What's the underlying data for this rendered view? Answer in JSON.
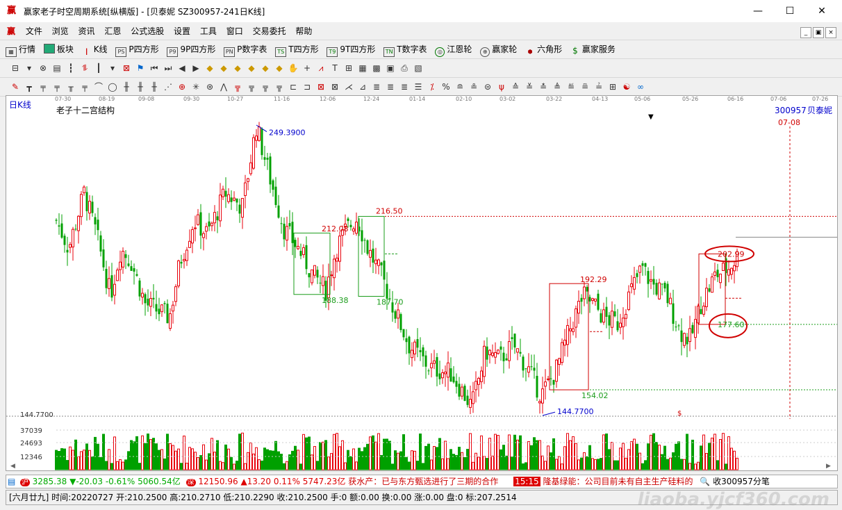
{
  "window": {
    "title": "赢家老子时空周期系统[纵横版] - [贝泰妮  SZ300957-241日K线]",
    "logo": "赢",
    "min_glyph": "—",
    "max_glyph": "☐",
    "close_glyph": "✕"
  },
  "menu": [
    "文件",
    "浏览",
    "资讯",
    "汇恩",
    "公式选股",
    "设置",
    "工具",
    "窗口",
    "交易委托",
    "帮助"
  ],
  "mdi_buttons": [
    "_",
    "▣",
    "×"
  ],
  "toolbar1": [
    {
      "icon": "grid-icon",
      "label": "行情"
    },
    {
      "icon": "blocks-icon",
      "label": "板块"
    },
    {
      "icon": "kline-icon",
      "label": "K线"
    },
    {
      "icon": "ps-icon",
      "label": "P四方形"
    },
    {
      "icon": "p9-icon",
      "label": "9P四方形"
    },
    {
      "icon": "pn-icon",
      "label": "P数字表"
    },
    {
      "icon": "ts-icon",
      "label": "T四方形"
    },
    {
      "icon": "t9-icon",
      "label": "9T四方形"
    },
    {
      "icon": "tn-icon",
      "label": "T数字表"
    },
    {
      "icon": "target-icon",
      "label": "江恩轮"
    },
    {
      "icon": "wheel-icon",
      "label": "赢家轮"
    },
    {
      "icon": "hexagon-icon",
      "label": "六角形"
    },
    {
      "icon": "dollar-icon",
      "label": "赢家服务"
    }
  ],
  "chart_header": {
    "period": "日K线",
    "indicator": "老子十二宫结构",
    "code": "300957",
    "name": "贝泰妮",
    "cursor_date": "07-08"
  },
  "date_axis": [
    "07-30",
    "08-19",
    "09-08",
    "09-30",
    "10-27",
    "11-16",
    "12-06",
    "12-24",
    "01-14",
    "02-10",
    "03-02",
    "03-22",
    "04-13",
    "05-06",
    "05-26",
    "06-16",
    "07-06",
    "07-26"
  ],
  "price_labels": {
    "high": "249.3900",
    "low": "144.7700",
    "low_left": "144.7700",
    "l216": "216.50",
    "l212": "212.08",
    "l188": "188.38",
    "l187": "187.70",
    "l192": "192.29",
    "l154": "154.02",
    "l202": "202.99",
    "l177": "177.60"
  },
  "volume_axis": [
    "37039",
    "24693",
    "12346"
  ],
  "status1": {
    "sh_icon": "沪",
    "sh_text": "3285.38 ▼-20.03 -0.61% 5060.54亿",
    "sz_icon": "深",
    "sz_text": "12150.96 ▲13.20 0.11% 5747.23亿",
    "news1": "获水产：已与东方甄选进行了三期的合作",
    "time": "15:15",
    "news2": "隆基绿能：公司目前未有自主生产硅料的",
    "receive": "收300957分笔"
  },
  "status2": "[六月廿九] 时间:20220727 开:210.2500 高:210.2710 低:210.2290 收:210.2500 手:0 额:0.00 换:0.00 涨:0.00 盘:0 标:207.2514",
  "watermark": "liaoba.yjcf360.com",
  "colors": {
    "up": "#e8000b",
    "down": "#00a000",
    "green_box": "#1a9c1a",
    "red_box": "#d00000",
    "blue_label": "#0000cc"
  },
  "chart_data": {
    "type": "candlestick",
    "title": "老子十二宫结构",
    "ylim": [
      144.77,
      249.39
    ],
    "volume_ticks": [
      12346,
      24693,
      37039
    ],
    "annotations": [
      {
        "label": "249.3900",
        "value": 249.39
      },
      {
        "label": "216.50",
        "value": 216.5
      },
      {
        "label": "212.08",
        "value": 212.08
      },
      {
        "label": "192.29",
        "value": 192.29
      },
      {
        "label": "202.99",
        "value": 202.99
      },
      {
        "label": "188.38",
        "value": 188.38
      },
      {
        "label": "187.70",
        "value": 187.7
      },
      {
        "label": "177.60",
        "value": 177.6
      },
      {
        "label": "154.02",
        "value": 154.02
      },
      {
        "label": "144.7700",
        "value": 144.77
      }
    ]
  }
}
